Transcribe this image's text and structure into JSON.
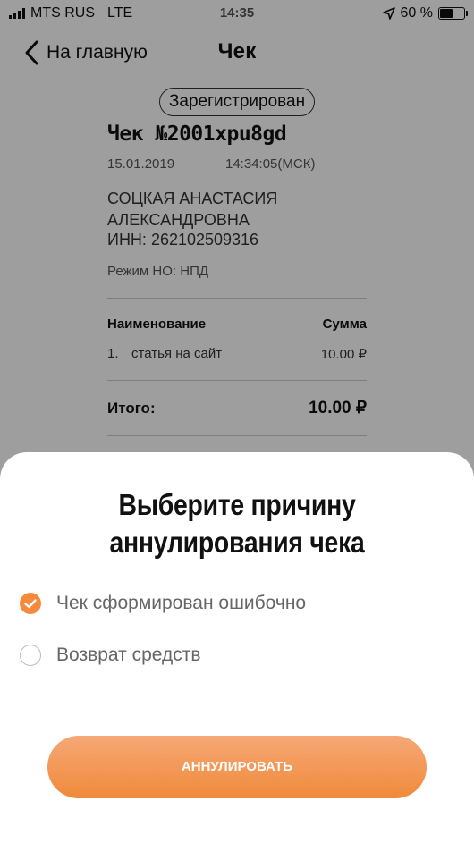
{
  "status_bar": {
    "carrier": "MTS RUS",
    "network": "LTE",
    "time": "14:35",
    "battery_percent": "60 %",
    "battery_level": 0.6
  },
  "nav": {
    "back_label": "На главную",
    "title": "Чек"
  },
  "receipt": {
    "status_badge": "Зарегистрирован",
    "title": "Чек №2001xpu8gd",
    "date": "15.01.2019",
    "time": "14:34:05(МСК)",
    "name_line1": "СОЦКАЯ АНАСТАСИЯ",
    "name_line2": "АЛЕКСАНДРОВНА",
    "inn": "ИНН: 262102509316",
    "regime": "Режим НО: НПД",
    "table": {
      "col_name": "Наименование",
      "col_sum": "Сумма",
      "rows": [
        {
          "num": "1.",
          "name": "статья на сайт",
          "sum": "10.00 ₽"
        }
      ]
    },
    "total_label": "Итого:",
    "total_sum": "10.00 ₽"
  },
  "sheet": {
    "title_line1": "Выберите причину",
    "title_line2": "аннулирования чека",
    "options": [
      {
        "label": "Чек сформирован ошибочно",
        "selected": true
      },
      {
        "label": "Возврат средств",
        "selected": false
      }
    ],
    "button_label": "АННУЛИРОВАТЬ"
  },
  "colors": {
    "accent": "#f08a3a",
    "accent_light": "#f6a877",
    "overlay": "rgba(0,0,0,0.38)"
  },
  "icons": {
    "back": "chevron-left-icon",
    "location": "location-arrow-icon",
    "check": "checkmark-icon"
  }
}
